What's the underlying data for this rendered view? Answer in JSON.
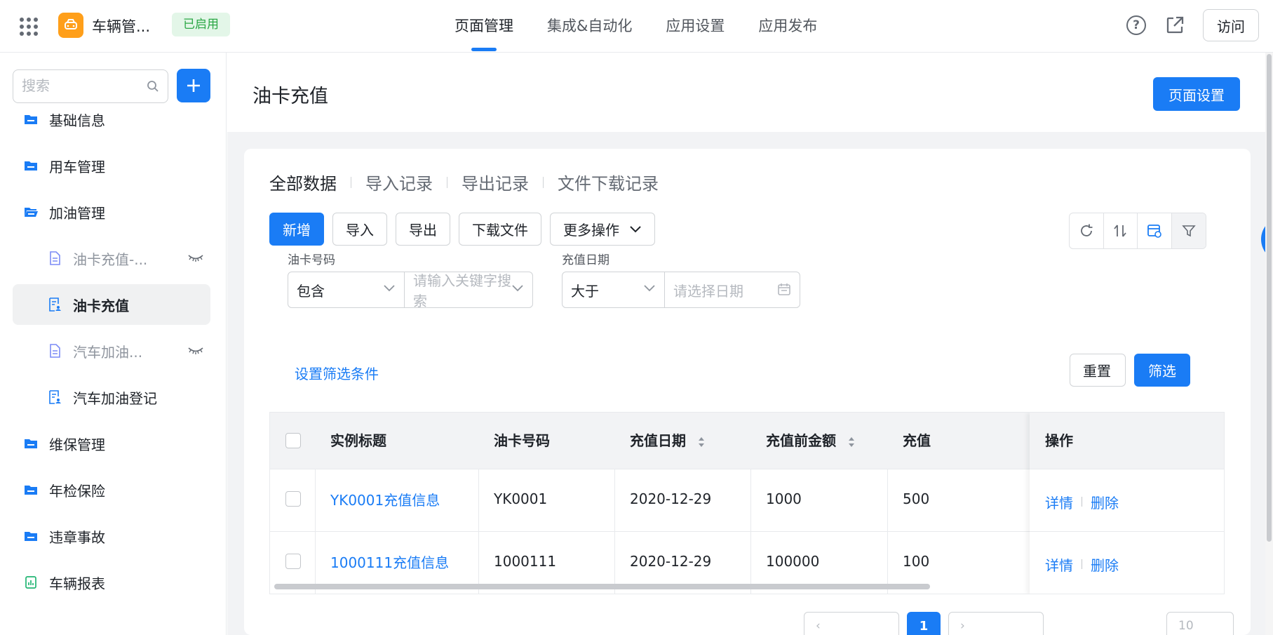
{
  "app": {
    "name": "车辆管...",
    "status": "已启用"
  },
  "top_nav": {
    "tabs": [
      {
        "label": "页面管理",
        "active": true
      },
      {
        "label": "集成&自动化"
      },
      {
        "label": "应用设置"
      },
      {
        "label": "应用发布"
      }
    ],
    "visit_label": "访问"
  },
  "sidebar": {
    "search_placeholder": "搜索",
    "items": [
      {
        "label": "基础信息",
        "type": "folder"
      },
      {
        "label": "用车管理",
        "type": "folder"
      },
      {
        "label": "加油管理",
        "type": "folder-open"
      },
      {
        "label": "油卡充值-...",
        "type": "page",
        "hidden": true
      },
      {
        "label": "油卡充值",
        "type": "form",
        "selected": true
      },
      {
        "label": "汽车加油...",
        "type": "page",
        "hidden": true
      },
      {
        "label": "汽车加油登记",
        "type": "form"
      },
      {
        "label": "维保管理",
        "type": "folder"
      },
      {
        "label": "年检保险",
        "type": "folder"
      },
      {
        "label": "违章事故",
        "type": "folder"
      },
      {
        "label": "车辆报表",
        "type": "report"
      }
    ]
  },
  "page": {
    "title": "油卡充值",
    "settings_label": "页面设置"
  },
  "data_tabs": [
    "全部数据",
    "导入记录",
    "导出记录",
    "文件下载记录"
  ],
  "toolbar": {
    "add": "新增",
    "import": "导入",
    "export": "导出",
    "download": "下载文件",
    "more": "更多操作"
  },
  "filters": [
    {
      "label": "油卡号码",
      "operator": "包含",
      "placeholder": "请输入关键字搜索"
    },
    {
      "label": "充值日期",
      "operator": "大于",
      "placeholder": "请选择日期"
    }
  ],
  "filter_actions": {
    "set_conditions": "设置筛选条件",
    "reset": "重置",
    "filter": "筛选"
  },
  "table": {
    "columns": [
      "实例标题",
      "油卡号码",
      "充值日期",
      "充值前金额",
      "充值",
      "操作"
    ],
    "rows": [
      {
        "title": "YK0001充值信息",
        "card_no": "YK0001",
        "date": "2020-12-29",
        "before": "1000",
        "amount": "500"
      },
      {
        "title": "1000111充值信息",
        "card_no": "1000111",
        "date": "2020-12-29",
        "before": "100000",
        "amount": "100"
      }
    ],
    "detail_label": "详情",
    "delete_label": "删除"
  },
  "colors": {
    "primary": "#1a7cf5",
    "status_green": "#2ba745",
    "logo_orange": "#ff9f1a"
  }
}
